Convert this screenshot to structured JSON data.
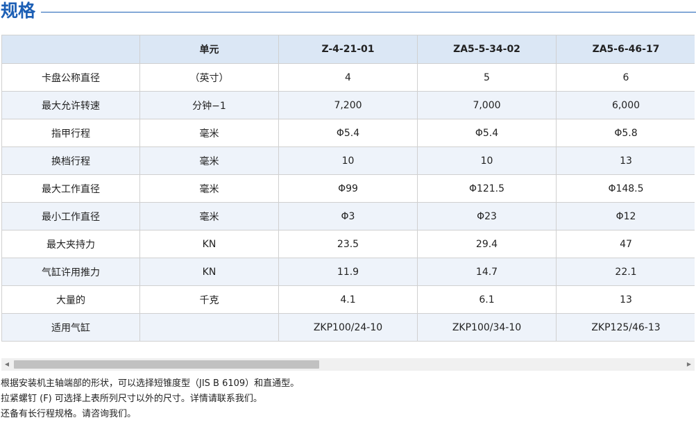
{
  "heading": {
    "title": "规格"
  },
  "table": {
    "headers": [
      "",
      "单元",
      "Z-4-21-01",
      "ZA5-5-34-02",
      "ZA5-6-46-17"
    ],
    "rows": [
      [
        "卡盘公称直径",
        "（英寸）",
        "4",
        "5",
        "6"
      ],
      [
        "最大允许转速",
        "分钟−1",
        "7,200",
        "7,000",
        "6,000"
      ],
      [
        "指甲行程",
        "毫米",
        "Φ5.4",
        "Φ5.4",
        "Φ5.8"
      ],
      [
        "换档行程",
        "毫米",
        "10",
        "10",
        "13"
      ],
      [
        "最大工作直径",
        "毫米",
        "Φ99",
        "Φ121.5",
        "Φ148.5"
      ],
      [
        "最小工作直径",
        "毫米",
        "Φ3",
        "Φ23",
        "Φ12"
      ],
      [
        "最大夹持力",
        "KN",
        "23.5",
        "29.4",
        "47"
      ],
      [
        "气缸许用推力",
        "KN",
        "11.9",
        "14.7",
        "22.1"
      ],
      [
        "大量的",
        "千克",
        "4.1",
        "6.1",
        "13"
      ],
      [
        "适用气缸",
        "",
        "ZKP100/24-10",
        "ZKP100/34-10",
        "ZKP125/46-13"
      ]
    ]
  },
  "scrollbar": {
    "left_arrow": "◀",
    "right_arrow": "▶"
  },
  "notes": [
    "根据安装机主轴端部的形状，可以选择短锥度型（JIS B 6109）和直通型。",
    "拉紧螺钉 (F) 可选择上表所列尺寸以外的尺寸。详情请联系我们。",
    "还备有长行程规格。请咨询我们。"
  ],
  "colors": {
    "accent": "#1c5fb5",
    "header_bg": "#dbe7f5",
    "alt_row_bg": "#eef3fa"
  }
}
